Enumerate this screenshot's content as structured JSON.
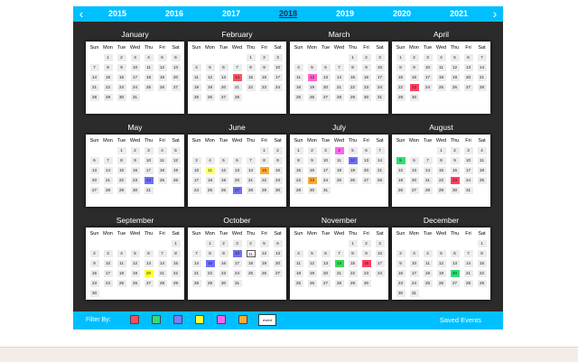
{
  "years": [
    "2015",
    "2016",
    "2017",
    "2018",
    "2019",
    "2020",
    "2021"
  ],
  "selected_year": "2018",
  "nav": {
    "prev": "‹",
    "next": "›"
  },
  "weekdays": [
    "Sun",
    "Mon",
    "Tue",
    "Wed",
    "Thu",
    "Fri",
    "Sat"
  ],
  "months": [
    {
      "name": "January",
      "offset": 1,
      "days": 31,
      "events": {}
    },
    {
      "name": "February",
      "offset": 4,
      "days": 28,
      "events": {
        "14": "#ff5060"
      }
    },
    {
      "name": "March",
      "offset": 4,
      "days": 31,
      "events": {
        "12": "#ff66cc"
      }
    },
    {
      "name": "April",
      "offset": 0,
      "days": 30,
      "events": {
        "23": "#ff4060"
      }
    },
    {
      "name": "May",
      "offset": 2,
      "days": 31,
      "events": {
        "24": "#6f6fff"
      }
    },
    {
      "name": "June",
      "offset": 5,
      "days": 30,
      "events": {
        "11": "#ffff66",
        "15": "#ffaa33",
        "27": "#6f6fff"
      }
    },
    {
      "name": "July",
      "offset": 0,
      "days": 31,
      "events": {
        "4": "#ff66ee",
        "12": "#6f6fff",
        "23": "#ffaa33"
      }
    },
    {
      "name": "August",
      "offset": 3,
      "days": 31,
      "events": {
        "5": "#33dd77",
        "23": "#ff4060"
      }
    },
    {
      "name": "September",
      "offset": 6,
      "days": 30,
      "events": {
        "20": "#ffff33"
      }
    },
    {
      "name": "October",
      "offset": 1,
      "days": 31,
      "events": {
        "10": "#6f6fff",
        "15": "#6f6fff"
      },
      "boxed": [
        11
      ]
    },
    {
      "name": "November",
      "offset": 4,
      "days": 30,
      "events": {
        "14": "#33dd55",
        "16": "#ff4060"
      }
    },
    {
      "name": "December",
      "offset": 6,
      "days": 31,
      "events": {
        "20": "#33dd77"
      }
    }
  ],
  "filter": {
    "label": "Filter By:",
    "colors": [
      "#ff4b5c",
      "#33dd77",
      "#7d7dff",
      "#ffff33",
      "#ff66ee",
      "#ffaa33"
    ],
    "event_button": "event"
  },
  "saved_events": "Saved Events"
}
